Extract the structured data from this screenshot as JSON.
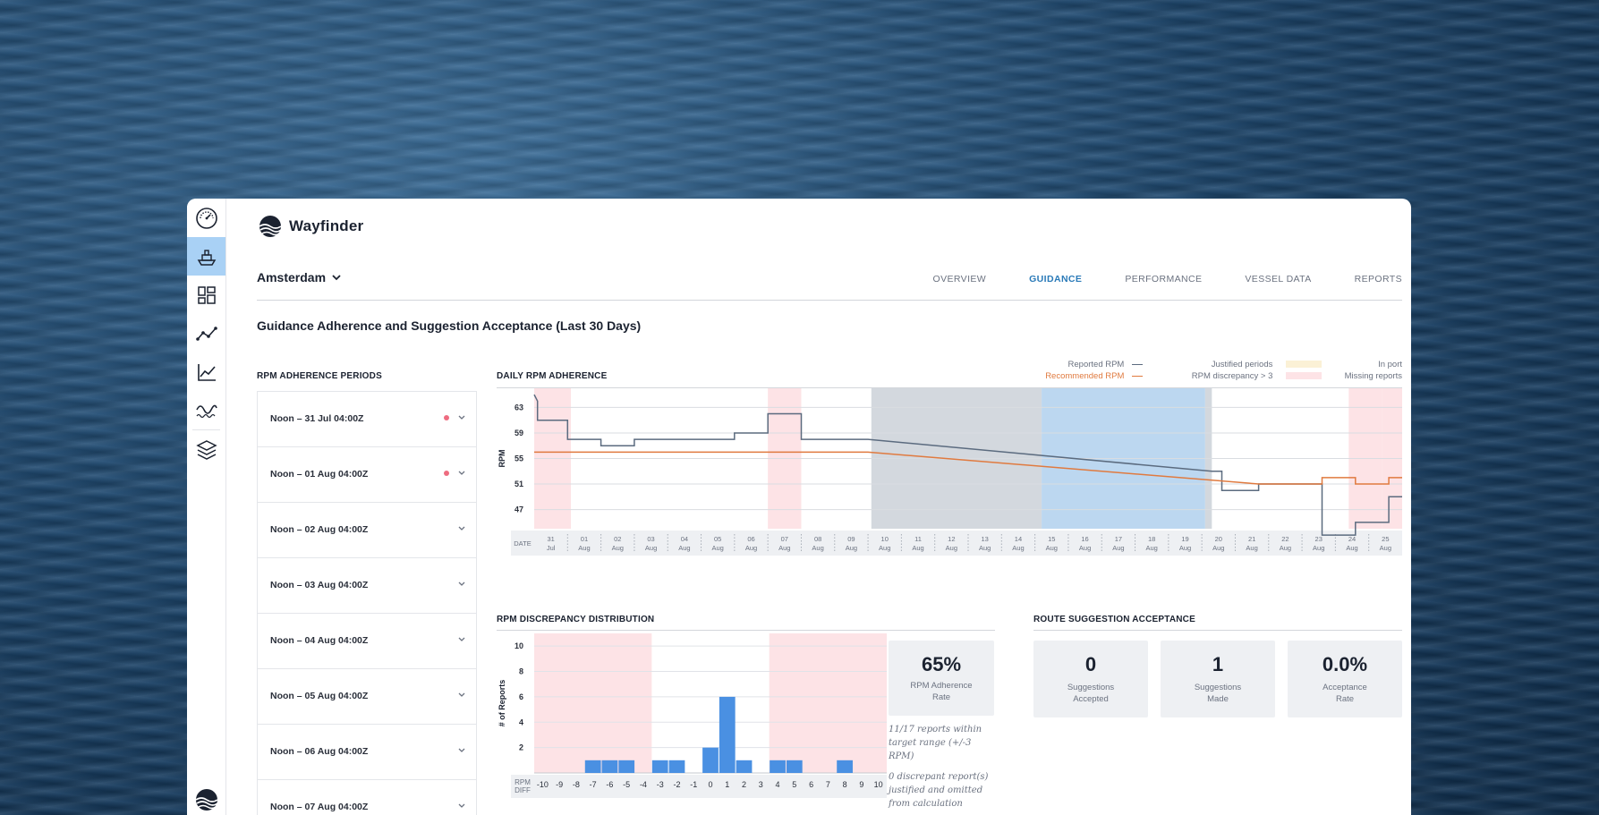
{
  "app": {
    "brand": "Wayfinder",
    "vessel": "Amsterdam"
  },
  "nav": [
    {
      "label": "OVERVIEW",
      "active": false
    },
    {
      "label": "GUIDANCE",
      "active": true
    },
    {
      "label": "PERFORMANCE",
      "active": false
    },
    {
      "label": "VESSEL DATA",
      "active": false
    },
    {
      "label": "REPORTS",
      "active": false
    }
  ],
  "rail": [
    "speedometer-icon",
    "ship-icon",
    "dashboard-grid-icon",
    "route-icon",
    "line-chart-icon",
    "weather-waves-icon",
    "layers-icon"
  ],
  "page_title": "Guidance Adherence and Suggestion Acceptance (Last 30 Days)",
  "periods": {
    "label": "RPM ADHERENCE PERIODS",
    "items": [
      {
        "label": "Noon – 31 Jul 04:00Z",
        "flag": true
      },
      {
        "label": "Noon – 01 Aug 04:00Z",
        "flag": true
      },
      {
        "label": "Noon – 02 Aug 04:00Z",
        "flag": false
      },
      {
        "label": "Noon – 03 Aug 04:00Z",
        "flag": false
      },
      {
        "label": "Noon – 04 Aug 04:00Z",
        "flag": false
      },
      {
        "label": "Noon – 05 Aug 04:00Z",
        "flag": false
      },
      {
        "label": "Noon – 06 Aug 04:00Z",
        "flag": false
      },
      {
        "label": "Noon – 07 Aug 04:00Z",
        "flag": false
      }
    ]
  },
  "daily": {
    "label": "DAILY RPM ADHERENCE",
    "legend": {
      "reported": "Reported RPM",
      "recommended": "Recommended RPM",
      "justified": "Justified periods",
      "discrepancy": "RPM discrepancy > 3",
      "in_port": "In port",
      "missing": "Missing reports"
    },
    "date_label": "DATE",
    "ylabel": "RPM"
  },
  "distribution": {
    "label": "RPM DISCREPANCY DISTRIBUTION",
    "ylabel": "# of Reports",
    "xlabel": "RPM DIFF",
    "rate_value": "65%",
    "rate_label": "RPM Adherence Rate",
    "note1": "11/17 reports within target range (+/-3 RPM)",
    "note2": "0 discrepant report(s) justified and omitted from calculation"
  },
  "acceptance": {
    "label": "ROUTE SUGGESTION ACCEPTANCE",
    "cards": [
      {
        "value": "0",
        "label": "Suggestions Accepted"
      },
      {
        "value": "1",
        "label": "Suggestions Made"
      },
      {
        "value": "0.0%",
        "label": "Acceptance Rate"
      }
    ]
  },
  "colors": {
    "reported": "#5b6b7f",
    "recommended": "#e07a3f",
    "discrepancy": "#fde3e6",
    "in_port": "#d3d8de",
    "missing": "#bcd7f0",
    "justified": "#fbf1d6",
    "bars": "#4a90e2"
  },
  "chart_data": [
    {
      "type": "line",
      "title": "DAILY RPM ADHERENCE",
      "ylabel": "RPM",
      "xlabel": "DATE",
      "yticks": [
        47,
        51,
        55,
        59,
        63
      ],
      "ylim": [
        44,
        66
      ],
      "x_ticks": [
        [
          "31",
          "Jul"
        ],
        [
          "01",
          "Aug"
        ],
        [
          "02",
          "Aug"
        ],
        [
          "03",
          "Aug"
        ],
        [
          "04",
          "Aug"
        ],
        [
          "05",
          "Aug"
        ],
        [
          "06",
          "Aug"
        ],
        [
          "07",
          "Aug"
        ],
        [
          "08",
          "Aug"
        ],
        [
          "09",
          "Aug"
        ],
        [
          "10",
          "Aug"
        ],
        [
          "11",
          "Aug"
        ],
        [
          "12",
          "Aug"
        ],
        [
          "13",
          "Aug"
        ],
        [
          "14",
          "Aug"
        ],
        [
          "15",
          "Aug"
        ],
        [
          "16",
          "Aug"
        ],
        [
          "17",
          "Aug"
        ],
        [
          "18",
          "Aug"
        ],
        [
          "19",
          "Aug"
        ],
        [
          "20",
          "Aug"
        ],
        [
          "21",
          "Aug"
        ],
        [
          "22",
          "Aug"
        ],
        [
          "23",
          "Aug"
        ],
        [
          "24",
          "Aug"
        ],
        [
          "25",
          "Aug"
        ]
      ],
      "x_domain": [
        0,
        26
      ],
      "series": [
        {
          "name": "Reported RPM",
          "color": "#5b6b7f",
          "points": [
            [
              0,
              65
            ],
            [
              0.1,
              64
            ],
            [
              0.1,
              61
            ],
            [
              1,
              61
            ],
            [
              1,
              58
            ],
            [
              2,
              58
            ],
            [
              2,
              57
            ],
            [
              3,
              57
            ],
            [
              3,
              58
            ],
            [
              6,
              58
            ],
            [
              6,
              59
            ],
            [
              7,
              59
            ],
            [
              7,
              62
            ],
            [
              8,
              62
            ],
            [
              8,
              58
            ],
            [
              10,
              58
            ],
            [
              20.3,
              53
            ],
            [
              20.6,
              53
            ],
            [
              20.6,
              50
            ],
            [
              21.7,
              50
            ],
            [
              21.7,
              51
            ],
            [
              23.6,
              51
            ],
            [
              23.6,
              43
            ],
            [
              24.6,
              43
            ],
            [
              24.6,
              45
            ],
            [
              25.6,
              45
            ],
            [
              25.6,
              49
            ],
            [
              26,
              49
            ]
          ]
        },
        {
          "name": "Recommended RPM",
          "color": "#e07a3f",
          "points": [
            [
              0,
              56
            ],
            [
              10,
              56
            ],
            [
              21.7,
              51
            ],
            [
              23.6,
              51
            ],
            [
              23.6,
              52
            ],
            [
              24.6,
              52
            ],
            [
              24.6,
              51
            ],
            [
              25.6,
              51
            ],
            [
              25.6,
              52
            ],
            [
              26,
              52
            ]
          ]
        }
      ],
      "bands": [
        {
          "kind": "discrepancy",
          "from": 0,
          "to": 1.1
        },
        {
          "kind": "discrepancy",
          "from": 7,
          "to": 8
        },
        {
          "kind": "in_port",
          "from": 10.1,
          "to": 15.2
        },
        {
          "kind": "missing",
          "from": 15.2,
          "to": 20.1
        },
        {
          "kind": "in_port",
          "from": 20.1,
          "to": 20.3
        },
        {
          "kind": "discrepancy",
          "from": 24.4,
          "to": 25.4
        },
        {
          "kind": "discrepancy",
          "from": 25.4,
          "to": 26
        }
      ]
    },
    {
      "type": "bar",
      "title": "RPM DISCREPANCY DISTRIBUTION",
      "ylabel": "# of Reports",
      "xlabel": "RPM DIFF",
      "categories": [
        -10,
        -9,
        -8,
        -7,
        -6,
        -5,
        -4,
        -3,
        -2,
        -1,
        0,
        1,
        2,
        3,
        4,
        5,
        6,
        7,
        8,
        9,
        10
      ],
      "values": [
        0,
        0,
        0,
        1,
        1,
        1,
        0,
        1,
        1,
        0,
        2,
        6,
        1,
        0,
        1,
        1,
        0,
        0,
        1,
        0,
        0
      ],
      "yticks": [
        2,
        4,
        6,
        8,
        10
      ],
      "ylim": [
        0,
        11
      ],
      "shaded_ranges": [
        [
          -10,
          -4
        ],
        [
          4,
          10
        ]
      ]
    }
  ]
}
